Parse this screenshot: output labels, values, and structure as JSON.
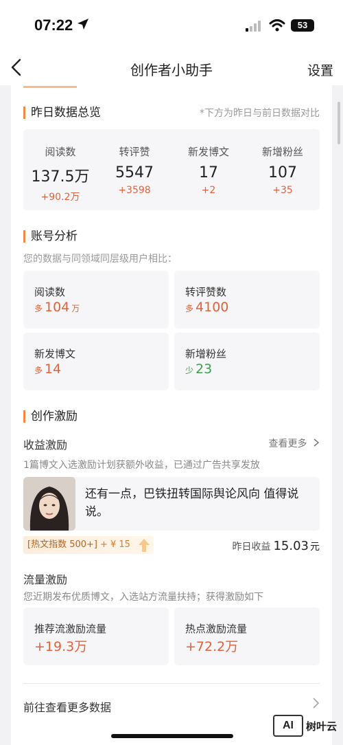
{
  "status_bar": {
    "time": "07:22",
    "battery": "53"
  },
  "nav": {
    "title": "创作者小助手",
    "settings": "设置"
  },
  "yesterday": {
    "title": "昨日数据总览",
    "note": "*下方为昨日与前日数据对比",
    "stats": [
      {
        "label": "阅读数",
        "value": "137.5万",
        "change": "+90.2万"
      },
      {
        "label": "转评赞",
        "value": "5547",
        "change": "+3598"
      },
      {
        "label": "新发博文",
        "value": "17",
        "change": "+2"
      },
      {
        "label": "新增粉丝",
        "value": "107",
        "change": "+35"
      }
    ]
  },
  "account": {
    "title": "账号分析",
    "subtitle": "您的数据与同领域同层级用户相比：",
    "items": [
      {
        "label": "阅读数",
        "prefix": "多",
        "value": "104",
        "unit": "万"
      },
      {
        "label": "转评赞数",
        "prefix": "多",
        "value": "4100",
        "unit": ""
      },
      {
        "label": "新发博文",
        "prefix": "多",
        "value": "14",
        "unit": ""
      },
      {
        "label": "新增粉丝",
        "prefix": "少",
        "value": "23",
        "unit": ""
      }
    ]
  },
  "incentive": {
    "title": "创作激励",
    "revenue": {
      "title": "收益激励",
      "more": "查看更多",
      "desc": "1篇博文入选激励计划获额外收益，已通过广告共享发放",
      "post_text": "还有一点，巴铁扭转国际舆论风向 值得说说。",
      "hot_tag": "[热文指数 500+]",
      "hot_money": "+ ¥ 15",
      "earn_label": "昨日收益",
      "earn_amount": "15.03",
      "earn_unit": "元"
    },
    "traffic": {
      "title": "流量激励",
      "desc": "您近期发布优质博文，入选站方流量扶持；获得激励如下",
      "items": [
        {
          "label": "推荐流激励流量",
          "value": "+19.3万"
        },
        {
          "label": "热点激励流量",
          "value": "+72.2万"
        }
      ]
    }
  },
  "footer_link": "前往查看更多数据",
  "watermark": {
    "logo": "AI",
    "text": "树叶云"
  }
}
